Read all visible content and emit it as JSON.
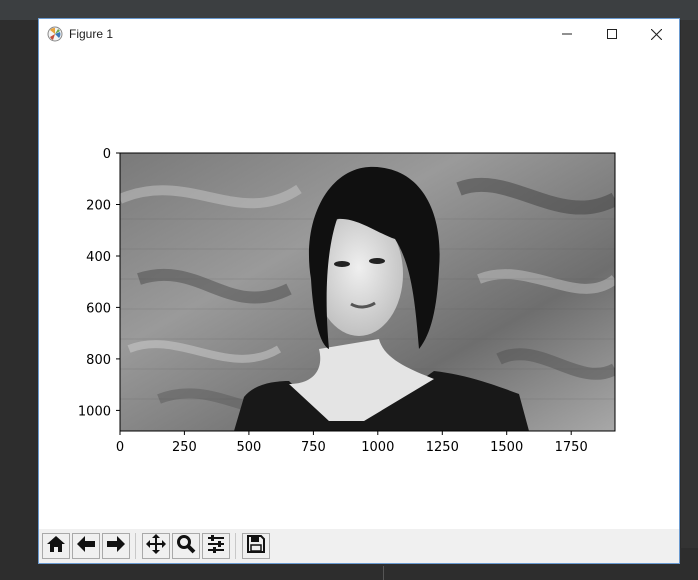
{
  "window": {
    "title": "Figure 1"
  },
  "window_controls": {
    "minimize": "minimize",
    "maximize": "maximize",
    "close": "close"
  },
  "axes": {
    "xticks": [
      "0",
      "250",
      "500",
      "750",
      "1000",
      "1250",
      "1500",
      "1750"
    ],
    "yticks": [
      "0",
      "200",
      "400",
      "600",
      "800",
      "1000"
    ],
    "xlim": [
      0,
      1920
    ],
    "ylim": [
      1080,
      0
    ],
    "image": "grayscale portrait photograph of a woman with short dark hair against a brushed graffiti wall"
  },
  "toolbar": {
    "buttons": [
      {
        "name": "home-button",
        "icon": "home-icon"
      },
      {
        "name": "back-button",
        "icon": "arrow-left-icon"
      },
      {
        "name": "forward-button",
        "icon": "arrow-right-icon"
      },
      {
        "name": "pan-button",
        "icon": "move-icon"
      },
      {
        "name": "zoom-button",
        "icon": "magnifier-icon"
      },
      {
        "name": "configure-subplots-button",
        "icon": "sliders-icon"
      },
      {
        "name": "save-button",
        "icon": "floppy-disk-icon"
      }
    ]
  }
}
